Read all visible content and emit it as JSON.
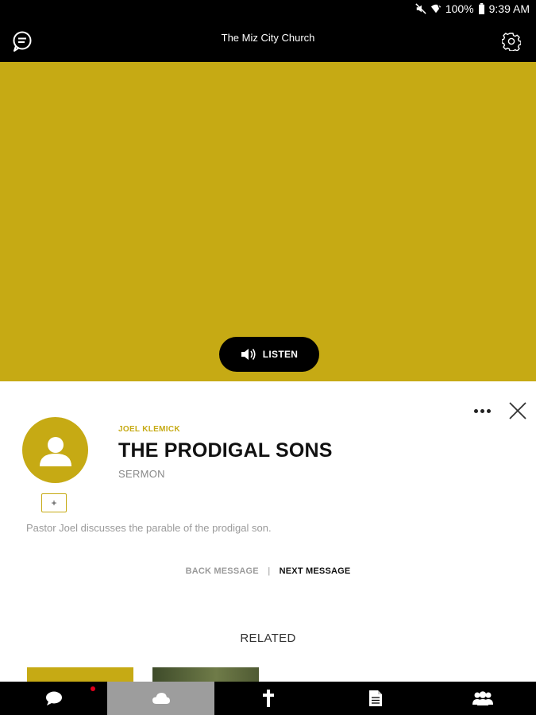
{
  "status_bar": {
    "battery": "100%",
    "time": "9:39 AM"
  },
  "header": {
    "title": "The Miz City Church"
  },
  "hero": {
    "listen_label": "LISTEN"
  },
  "message": {
    "speaker": "JOEL KLEMICK",
    "title": "THE PRODIGAL SONS",
    "category": "SERMON",
    "description": "Pastor Joel discusses the parable of the prodigal son.",
    "follow_label": "+"
  },
  "navigation": {
    "back_label": "BACK MESSAGE",
    "separator": "|",
    "next_label": "NEXT MESSAGE"
  },
  "related": {
    "title": "RELATED"
  },
  "tabs": [
    {
      "icon": "chat-icon",
      "active": false,
      "has_badge": true
    },
    {
      "icon": "cloud-icon",
      "active": true,
      "has_badge": false
    },
    {
      "icon": "cross-icon",
      "active": false,
      "has_badge": false
    },
    {
      "icon": "document-icon",
      "active": false,
      "has_badge": false
    },
    {
      "icon": "group-icon",
      "active": false,
      "has_badge": false
    }
  ],
  "colors": {
    "accent": "#c6aa14",
    "bar": "#000000",
    "active_tab": "#9d9d9d",
    "badge": "#e0001a"
  }
}
